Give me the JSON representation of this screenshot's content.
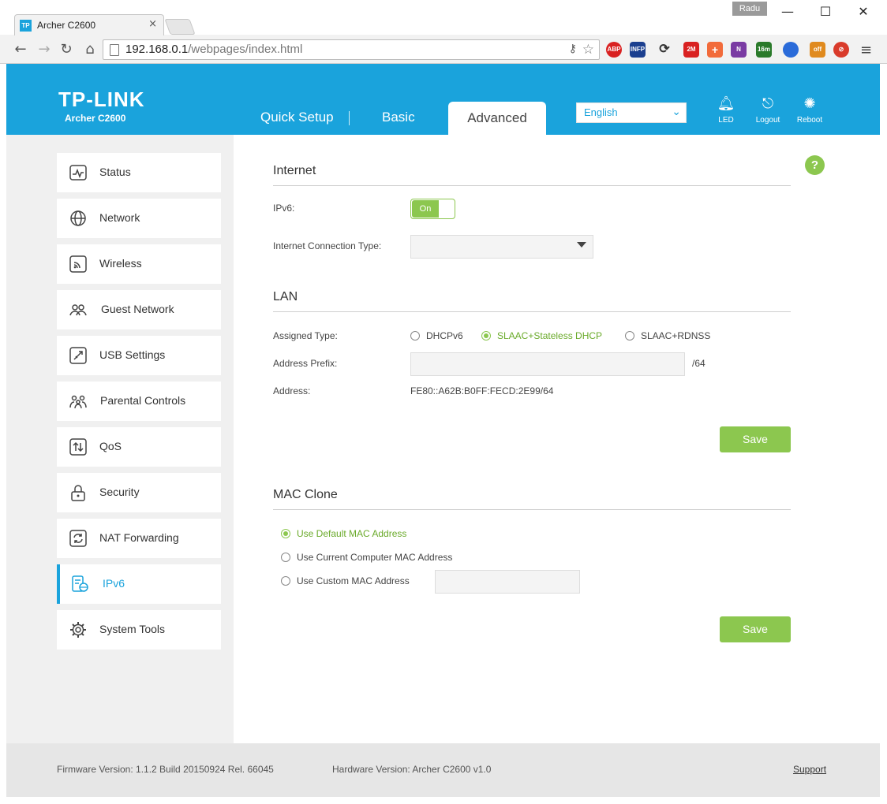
{
  "browser": {
    "tab_title": "Archer C2600",
    "tab_favicon": "TP",
    "profile": "Radu",
    "url_host": "192.168.0.1",
    "url_path": "/webpages/index.html",
    "extensions": [
      "ABP",
      "INFP",
      "2M",
      "16m",
      "off"
    ]
  },
  "header": {
    "logo": "TP-LINK",
    "model": "Archer C2600",
    "nav": [
      "Quick Setup",
      "Basic",
      "Advanced"
    ],
    "language": "English",
    "icons": {
      "led": "LED",
      "logout": "Logout",
      "reboot": "Reboot"
    }
  },
  "sidebar": {
    "items": [
      {
        "label": "Status",
        "icon": "pulse-icon"
      },
      {
        "label": "Network",
        "icon": "globe-icon"
      },
      {
        "label": "Wireless",
        "icon": "wireless-icon"
      },
      {
        "label": "Guest Network",
        "icon": "guest-users-icon"
      },
      {
        "label": "USB Settings",
        "icon": "usb-icon"
      },
      {
        "label": "Parental Controls",
        "icon": "family-icon"
      },
      {
        "label": "QoS",
        "icon": "qos-arrows-icon"
      },
      {
        "label": "Security",
        "icon": "lock-icon"
      },
      {
        "label": "NAT Forwarding",
        "icon": "refresh-icon"
      },
      {
        "label": "IPv6",
        "icon": "ipv6-icon"
      },
      {
        "label": "System Tools",
        "icon": "gear-icon"
      }
    ],
    "active_index": 9
  },
  "internet": {
    "title": "Internet",
    "ipv6_label": "IPv6:",
    "toggle_value": "On",
    "conn_type_label": "Internet Connection Type:",
    "conn_type_value": ""
  },
  "lan": {
    "title": "LAN",
    "assigned_label": "Assigned Type:",
    "options": [
      "DHCPv6",
      "SLAAC+Stateless DHCP",
      "SLAAC+RDNSS"
    ],
    "selected": 1,
    "prefix_label": "Address Prefix:",
    "prefix_value": "",
    "prefix_suffix": "/64",
    "address_label": "Address:",
    "address_value": "FE80::A62B:B0FF:FECD:2E99/64",
    "save": "Save"
  },
  "mac": {
    "title": "MAC Clone",
    "options": [
      "Use Default MAC Address",
      "Use Current Computer MAC Address",
      "Use Custom MAC Address"
    ],
    "selected": 0,
    "custom_value": "",
    "save": "Save"
  },
  "footer": {
    "firmware": "Firmware Version: 1.1.2 Build 20150924 Rel. 66045",
    "hardware": "Hardware Version: Archer C2600 v1.0",
    "support": "Support"
  }
}
